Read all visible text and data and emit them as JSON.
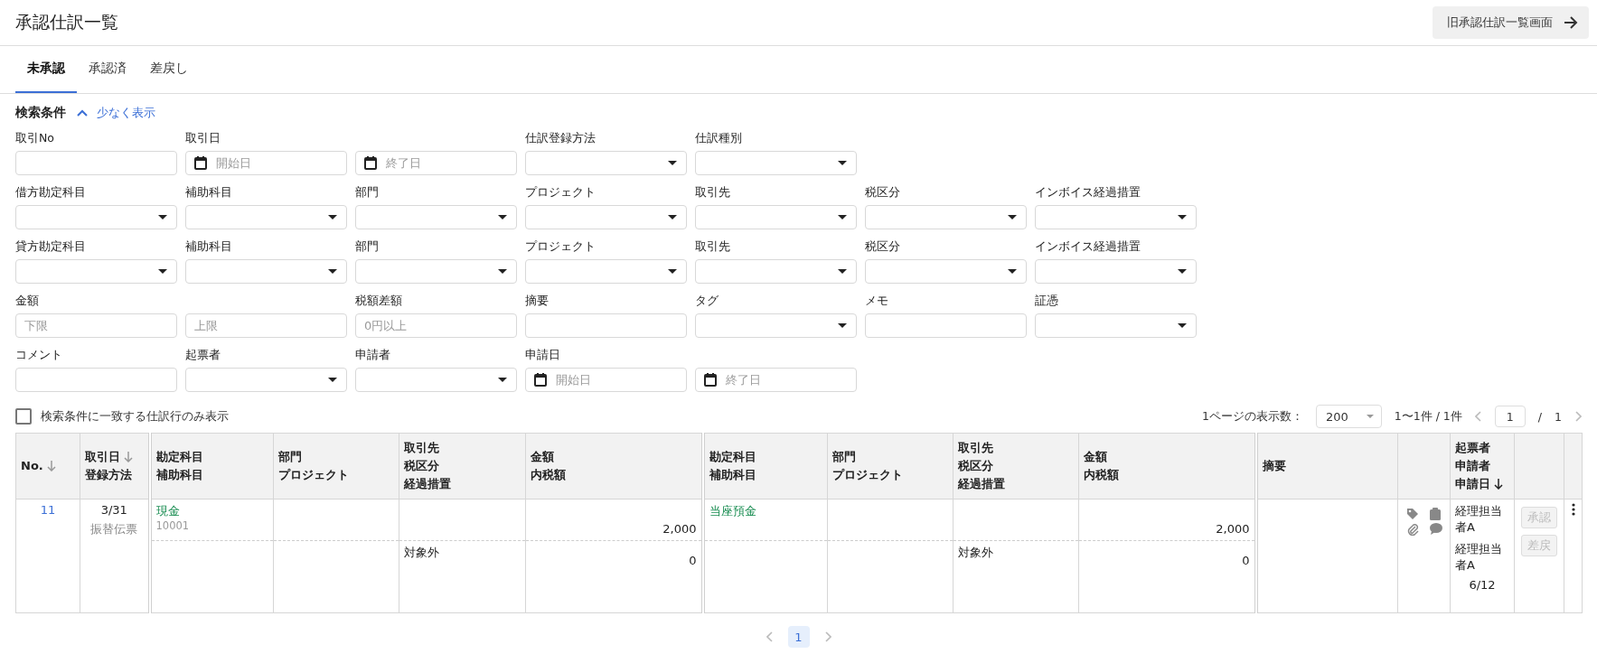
{
  "header": {
    "title": "承認仕訳一覧",
    "back_button": "旧承認仕訳一覧画面"
  },
  "tabs": [
    {
      "label": "未承認",
      "selected": true
    },
    {
      "label": "承認済",
      "selected": false
    },
    {
      "label": "差戻し",
      "selected": false
    }
  ],
  "search": {
    "title": "検索条件",
    "toggle": "少なく表示",
    "rows": [
      [
        {
          "label": "取引No",
          "kind": "text"
        },
        {
          "label": "取引日",
          "kind": "date",
          "placeholder": "開始日"
        },
        {
          "kind": "date",
          "placeholder": "終了日"
        },
        {
          "label": "仕訳登録方法",
          "kind": "select"
        },
        {
          "label": "仕訳種別",
          "kind": "select"
        }
      ],
      [
        {
          "label": "借方勘定科目",
          "kind": "select"
        },
        {
          "label": "補助科目",
          "kind": "select"
        },
        {
          "label": "部門",
          "kind": "select"
        },
        {
          "label": "プロジェクト",
          "kind": "select"
        },
        {
          "label": "取引先",
          "kind": "select"
        },
        {
          "label": "税区分",
          "kind": "select"
        },
        {
          "label": "インボイス経過措置",
          "kind": "select"
        }
      ],
      [
        {
          "label": "貸方勘定科目",
          "kind": "select"
        },
        {
          "label": "補助科目",
          "kind": "select"
        },
        {
          "label": "部門",
          "kind": "select"
        },
        {
          "label": "プロジェクト",
          "kind": "select"
        },
        {
          "label": "取引先",
          "kind": "select"
        },
        {
          "label": "税区分",
          "kind": "select"
        },
        {
          "label": "インボイス経過措置",
          "kind": "select"
        }
      ],
      [
        {
          "label": "金額",
          "kind": "text",
          "placeholder": "下限"
        },
        {
          "kind": "text",
          "placeholder": "上限"
        },
        {
          "label": "税額差額",
          "kind": "text",
          "placeholder": "0円以上"
        },
        {
          "label": "摘要",
          "kind": "text"
        },
        {
          "label": "タグ",
          "kind": "select"
        },
        {
          "label": "メモ",
          "kind": "text"
        },
        {
          "label": "証憑",
          "kind": "select"
        }
      ],
      [
        {
          "label": "コメント",
          "kind": "text"
        },
        {
          "label": "起票者",
          "kind": "select"
        },
        {
          "label": "申請者",
          "kind": "select"
        },
        {
          "label": "申請日",
          "kind": "date",
          "placeholder": "開始日"
        },
        {
          "kind": "date",
          "placeholder": "終了日"
        }
      ]
    ]
  },
  "filter_checkbox": {
    "label": "検索条件に一致する仕訳行のみ表示",
    "checked": false
  },
  "paging": {
    "per_page_label": "1ページの表示数：",
    "per_page": "200",
    "range": "1〜1件 / 1件",
    "page": "1",
    "separator": "/",
    "total": "1"
  },
  "table": {
    "columns": [
      {
        "lines": [
          {
            "text": "No.",
            "sort_arrow": true,
            "sort_active": false
          }
        ]
      },
      {
        "lines": [
          {
            "text": "取引日",
            "sort_arrow": true,
            "sort_active": false
          },
          {
            "text": "登録方法"
          }
        ]
      },
      {
        "lines": [
          {
            "text": "勘定科目"
          },
          {
            "text": "補助科目"
          }
        ]
      },
      {
        "lines": [
          {
            "text": "部門"
          },
          {
            "text": "プロジェクト"
          }
        ]
      },
      {
        "lines": [
          {
            "text": "取引先"
          },
          {
            "text": "税区分"
          },
          {
            "text": "経過措置"
          }
        ]
      },
      {
        "lines": [
          {
            "text": "金額"
          },
          {
            "text": "内税額"
          }
        ]
      },
      {
        "lines": [
          {
            "text": "勘定科目"
          },
          {
            "text": "補助科目"
          }
        ]
      },
      {
        "lines": [
          {
            "text": "部門"
          },
          {
            "text": "プロジェクト"
          }
        ]
      },
      {
        "lines": [
          {
            "text": "取引先"
          },
          {
            "text": "税区分"
          },
          {
            "text": "経過措置"
          }
        ]
      },
      {
        "lines": [
          {
            "text": "金額"
          },
          {
            "text": "内税額"
          }
        ]
      },
      {
        "lines": [
          {
            "text": "摘要"
          }
        ]
      },
      {},
      {
        "lines": [
          {
            "text": "起票者"
          },
          {
            "text": "申請者"
          },
          {
            "text": "申請日",
            "sort_arrow": true,
            "sort_active": true
          }
        ]
      },
      {},
      {}
    ],
    "rows": [
      {
        "no": "11",
        "date": "3/31",
        "method": "振替伝票",
        "debit": {
          "account": "現金",
          "sub_account": "10001",
          "amount": "2,000",
          "tax": "対象外",
          "tax_amount": "0"
        },
        "credit": {
          "account": "当座預金",
          "amount": "2,000",
          "tax": "対象外",
          "tax_amount": "0"
        },
        "creator": "経理担当者A",
        "applicant": "経理担当者A",
        "applied": "6/12",
        "actions": [
          {
            "label": "承認",
            "disabled": true
          },
          {
            "label": "差戻",
            "disabled": true
          }
        ]
      }
    ]
  },
  "pager": [
    {
      "label": "1",
      "selected": true
    }
  ]
}
